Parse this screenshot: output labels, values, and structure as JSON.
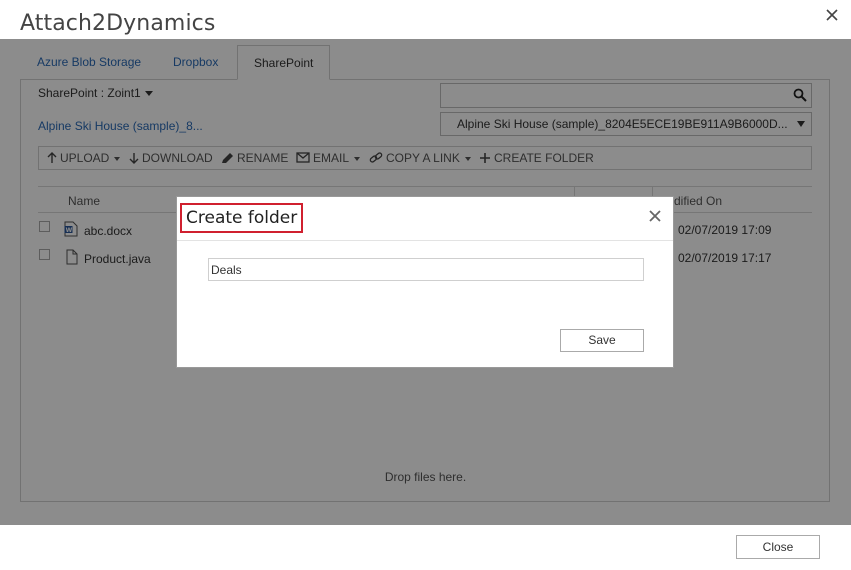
{
  "window": {
    "title": "Attach2Dynamics"
  },
  "tabs": [
    {
      "label": "Azure Blob Storage"
    },
    {
      "label": "Dropbox"
    },
    {
      "label": "SharePoint"
    }
  ],
  "sharepoint": {
    "selector_label": "SharePoint : Zoint1",
    "breadcrumb": "Alpine Ski House (sample)_8...",
    "site_value": "Alpine Ski House (sample)_8204E5ECE19BE911A9B6000D..."
  },
  "toolbar": {
    "upload": "UPLOAD",
    "download": "DOWNLOAD",
    "rename": "RENAME",
    "email": "EMAIL",
    "copy_link": "COPY A LINK",
    "create_folder": "CREATE FOLDER"
  },
  "grid": {
    "columns": {
      "name": "Name",
      "modified": "dified On"
    },
    "rows": [
      {
        "name": "abc.docx",
        "modified": "02/07/2019 17:09",
        "icon": "word-doc-icon"
      },
      {
        "name": "Product.java",
        "modified": "02/07/2019 17:17",
        "icon": "file-icon"
      }
    ]
  },
  "drop_text": "Drop files here.",
  "footer": {
    "close_label": "Close"
  },
  "modal": {
    "title": "Create folder",
    "folder_name_value": "Deals",
    "save_label": "Save",
    "highlight_color": "#d0202f"
  }
}
